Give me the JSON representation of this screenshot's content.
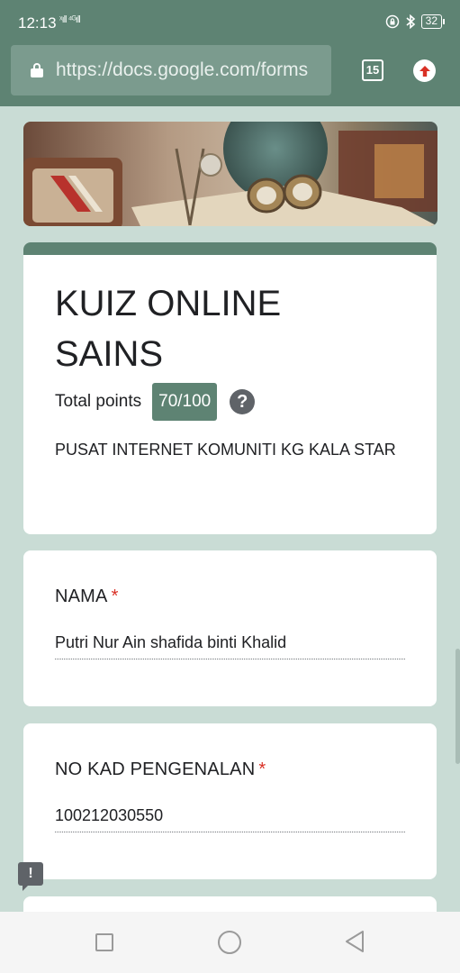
{
  "status_bar": {
    "time": "12:13",
    "signal_text": "ˣıll ⁴ᴳıll",
    "battery": "32",
    "icons": [
      "lock-rotation-icon",
      "bluetooth-icon",
      "battery-icon"
    ]
  },
  "browser": {
    "url": "https://docs.google.com/forms",
    "tab_count": "15",
    "icons": [
      "lock-icon",
      "tabs-icon",
      "update-icon"
    ]
  },
  "form": {
    "title": "KUIZ ONLINE SAINS",
    "points_label": "Total points",
    "points_value": "70/100",
    "help_icon": "?",
    "description": "PUSAT INTERNET KOMUNITI KG KALA STAR",
    "questions": [
      {
        "label": "NAMA",
        "required_mark": "*",
        "answer": "Putri Nur Ain shafida binti Khalid"
      },
      {
        "label": "NO KAD PENGENALAN",
        "required_mark": "*",
        "answer": "100212030550"
      }
    ]
  },
  "feedback_icon": "!",
  "colors": {
    "theme": "#5e8373",
    "background": "#c9dcd5",
    "required": "#d93025"
  }
}
